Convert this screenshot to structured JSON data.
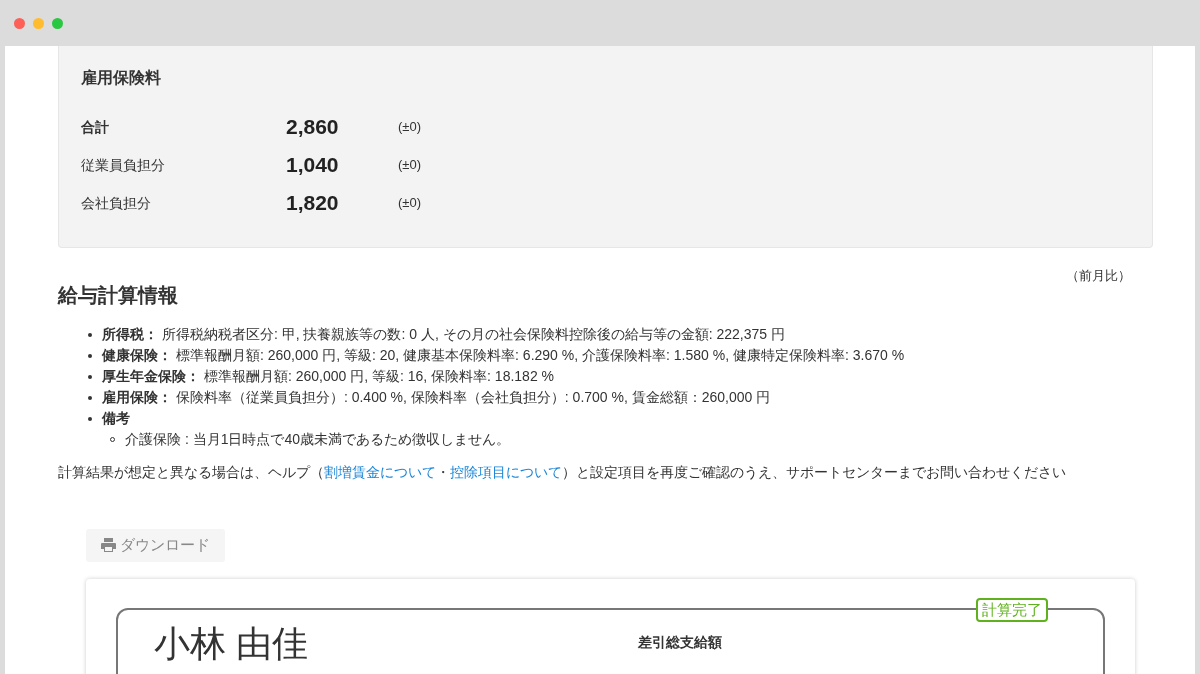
{
  "insurance_card": {
    "title": "雇用保険料",
    "rows": [
      {
        "label": "合計",
        "value": "2,860",
        "diff": "(±0)",
        "bold": true
      },
      {
        "label": "従業員負担分",
        "value": "1,040",
        "diff": "(±0)",
        "bold": false
      },
      {
        "label": "会社負担分",
        "value": "1,820",
        "diff": "(±0)",
        "bold": false
      }
    ]
  },
  "comparison_note": "（前月比）",
  "calc_info": {
    "title": "給与計算情報",
    "items": [
      {
        "text": "**所得税：** 所得税納税者区分: 甲, 扶養親族等の数: 0 人, その月の社会保険料控除後の給与等の金額: 222,375 円"
      },
      {
        "text": "**健康保険：** 標準報酬月額: 260,000 円, 等級: 20, 健康基本保険料率: 6.290 %, 介護保険料率: 1.580 %, 健康特定保険料率: 3.670 %"
      },
      {
        "text": "**厚生年金保険：** 標準報酬月額: 260,000 円, 等級: 16, 保険料率: 18.182 %"
      },
      {
        "text": "**雇用保険：** 保険料率（従業員負担分）: 0.400 %, 保険料率（会社負担分）: 0.700 %, 賃金総額：260,000 円"
      },
      {
        "text": "**備考**",
        "children": [
          {
            "text": "介護保険 : 当月1日時点で40歳未満であるため徴収しません。"
          }
        ]
      }
    ],
    "help": {
      "before": "計算結果が想定と異なる場合は、ヘルプ（",
      "link_1": "割増賃金について",
      "separator": "・",
      "link_2": "控除項目について",
      "after": "）と設定項目を再度ご確認のうえ、サポートセンターまでお問い合わせください"
    }
  },
  "download_button": "ダウンロード",
  "payslip": {
    "status": "計算完了",
    "employee_name": "小林 由佳",
    "net_pay_label": "差引総支給額"
  }
}
